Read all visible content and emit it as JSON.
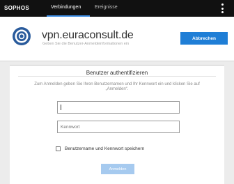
{
  "app": {
    "brand": "SOPHOS"
  },
  "nav": {
    "tabs": [
      {
        "label": "Verbindungen",
        "active": true
      },
      {
        "label": "Ereignisse",
        "active": false
      }
    ],
    "menu_icon": "kebab-menu-icon"
  },
  "header": {
    "logo_icon": "connection-target-icon",
    "title": "vpn.euraconsult.de",
    "subtitle": "Geben Sie die Benutzer-Anmeldeinformationen ein",
    "cancel_label": "Abbrechen"
  },
  "auth": {
    "title": "Benutzer authentifizieren",
    "instructions": "Zum Anmelden geben Sie Ihren Benutzernamen und Ihr Kennwort ein und klicken Sie auf „Anmelden“.",
    "username_value": "",
    "password_placeholder": "Kennwort",
    "remember_label": "Benutzername und Kennwort speichern",
    "remember_checked": false,
    "login_label": "Anmelden"
  },
  "colors": {
    "accent": "#1f7ed6",
    "topbar": "#111111",
    "login_disabled": "#a6caef"
  }
}
